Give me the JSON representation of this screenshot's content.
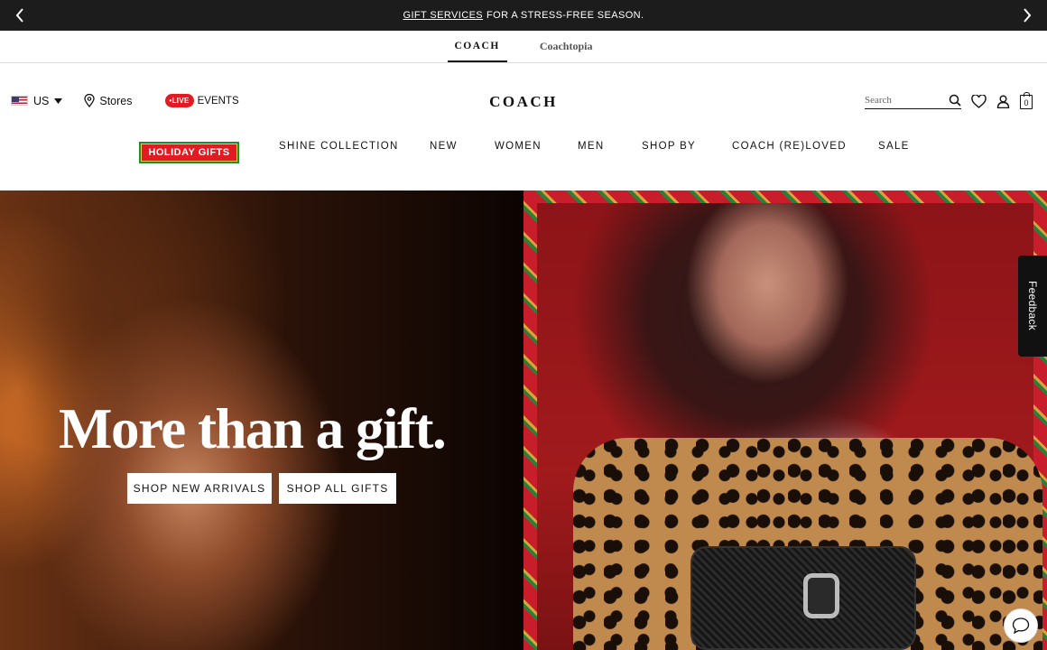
{
  "promo": {
    "link_text": "GIFT SERVICES",
    "text": "FOR A STRESS-FREE SEASON."
  },
  "brand_tabs": [
    {
      "label": "COACH"
    },
    {
      "label": "Coachtopia"
    }
  ],
  "utility": {
    "country": "US",
    "stores": "Stores",
    "live_badge": "•LIVE",
    "events": "EVENTS",
    "logo": "COACH",
    "search_placeholder": "Search",
    "bag_count": "0"
  },
  "nav": {
    "holiday": "HOLIDAY GIFTS",
    "items": [
      "SHINE COLLECTION",
      "NEW",
      "WOMEN",
      "MEN",
      "SHOP BY",
      "COACH (RE)LOVED",
      "SALE"
    ]
  },
  "hero": {
    "headline": "More than a gift.",
    "cta_primary": "SHOP NEW ARRIVALS",
    "cta_secondary": "SHOP ALL GIFTS"
  },
  "feedback": "Feedback",
  "icons": [
    "chevron-left-icon",
    "chevron-right-icon",
    "location-pin-icon",
    "search-icon",
    "heart-icon",
    "user-icon",
    "bag-icon",
    "chat-icon"
  ],
  "colors": {
    "promo_bg": "#1c1c1c",
    "live_red": "#e21b23",
    "holiday_green": "#1f8c35"
  }
}
